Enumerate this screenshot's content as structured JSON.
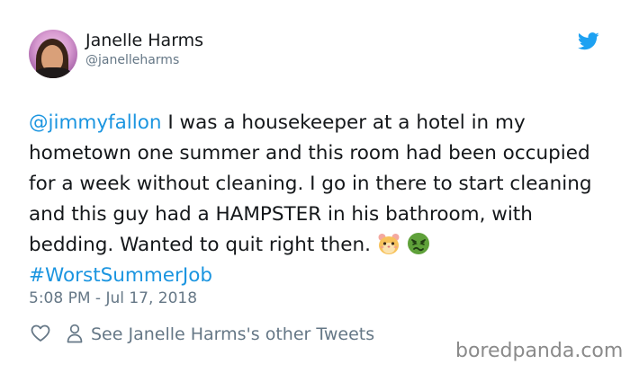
{
  "author": {
    "name": "Janelle Harms",
    "handle": "@janelleharms"
  },
  "tweet": {
    "mention": "@jimmyfallon",
    "body": " I was a housekeeper at a hotel in my hometown one summer and this room had been occupied for a week without cleaning. I go in there to start cleaning and this guy had a HAMPSTER in his bathroom, with bedding. Wanted to quit right then. ",
    "emojis": [
      "hamster-face",
      "nauseated-face"
    ],
    "hashtag": "#WorstSummerJob",
    "timestamp": "5:08 PM - Jul 17, 2018"
  },
  "actions": {
    "other_tweets_label": "See Janelle Harms's other Tweets"
  },
  "watermark": "boredpanda.com",
  "colors": {
    "link": "#1b95e0",
    "muted": "#657786",
    "text": "#14171a",
    "twitter_blue": "#1da1f2"
  }
}
